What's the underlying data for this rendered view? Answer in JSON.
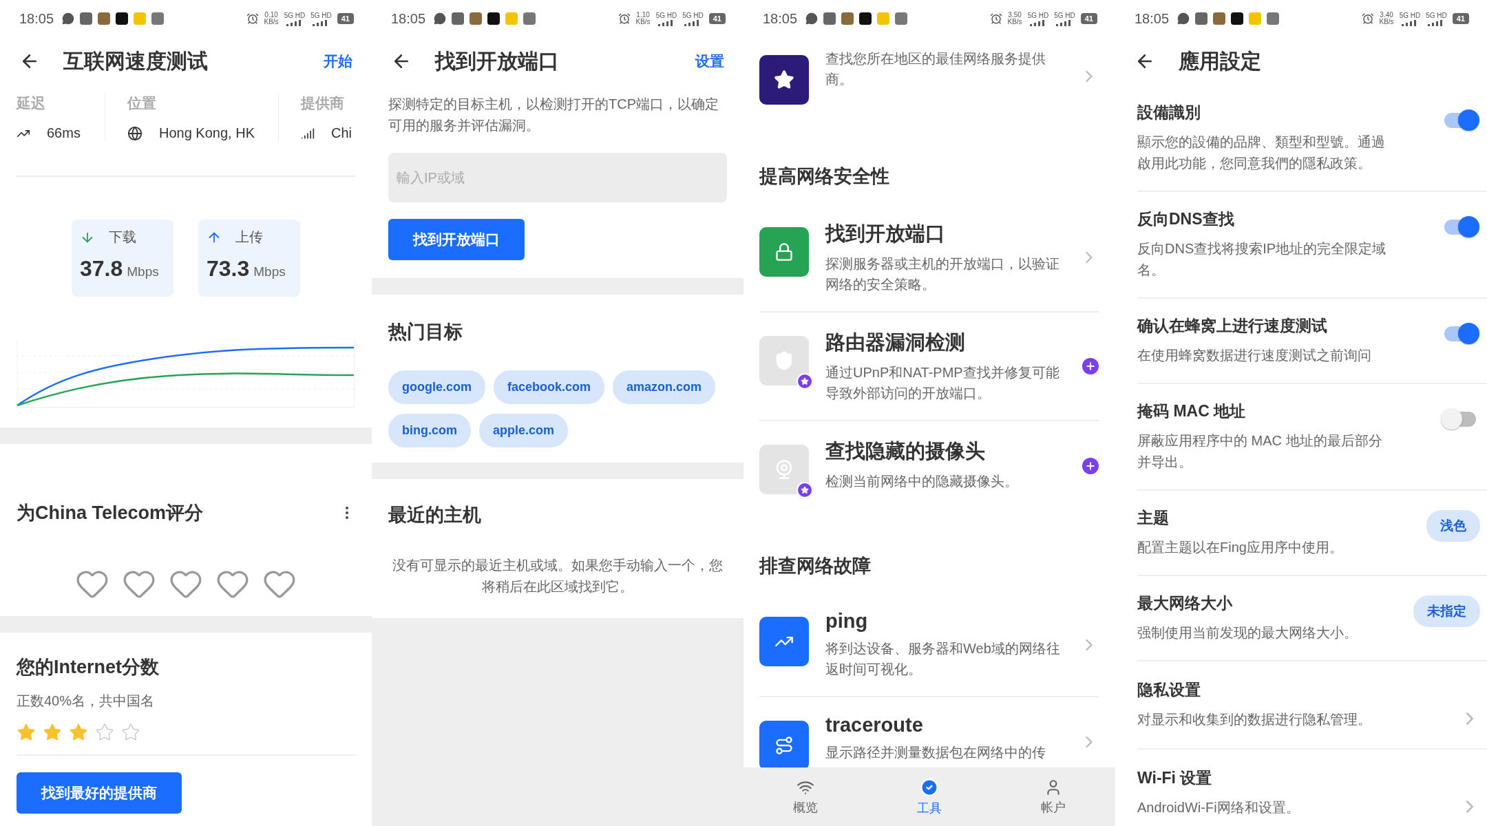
{
  "speed_test": {
    "status_bar": {
      "time": "18:05",
      "speed": "0.10",
      "speed_unit": "KB/s",
      "networks": [
        "5G HD",
        "5G HD"
      ],
      "battery": "41"
    },
    "title": "互联网速度测试",
    "action": "开始",
    "stats": [
      {
        "kind": "latency",
        "label": "延迟",
        "value": "66ms"
      },
      {
        "kind": "location",
        "label": "位置",
        "value": "Hong Kong, HK"
      },
      {
        "kind": "provider",
        "label": "提供商",
        "value": "Chi"
      }
    ],
    "speeds": [
      {
        "kind": "download",
        "label": "下载",
        "value": "37.8",
        "unit": "Mbps"
      },
      {
        "kind": "upload",
        "label": "上传",
        "value": "73.3",
        "unit": "Mbps"
      }
    ],
    "rating": {
      "title": "为China Telecom评分",
      "stars": 0
    },
    "score": {
      "title": "您的Internet分数",
      "subtitle": "正数40%名，共中国名",
      "stars": 3
    },
    "button": "找到最好的提供商"
  },
  "open_ports": {
    "status_bar": {
      "time": "18:05",
      "speed": "1.10",
      "speed_unit": "KB/s",
      "networks": [
        "5G HD",
        "5G HD"
      ],
      "battery": "41"
    },
    "title": "找到开放端口",
    "action": "设置",
    "description": "探测特定的目标主机，以检测打开的TCP端口，以确定可用的服务并评估漏洞。",
    "input": {
      "placeholder": "輸入IP或域"
    },
    "button": "找到开放端口",
    "popular": {
      "title": "热门目标",
      "targets": [
        "google.com",
        "facebook.com",
        "amazon.com",
        "bing.com",
        "apple.com"
      ]
    },
    "recent": {
      "title": "最近的主机",
      "empty_text": "没有可显示的最近主机或域。如果您手动输入一个，您将稍后在此区域找到它。"
    }
  },
  "tools": {
    "status_bar": {
      "time": "18:05",
      "speed": "3.50",
      "speed_unit": "KB/s",
      "networks": [
        "5G HD",
        "5G HD"
      ],
      "battery": "41"
    },
    "sections": [
      {
        "items": [
          {
            "kind": "compare",
            "description": "查找您所在地区的最佳网络服务提供商。",
            "premium": false
          }
        ]
      },
      {
        "title": "提高网络安全性",
        "items": [
          {
            "kind": "lock",
            "title": "找到开放端口",
            "description": "探测服务器或主机的开放端口，以验证网络的安全策略。",
            "premium": false
          },
          {
            "kind": "shield",
            "title": "路由器漏洞检测",
            "description": "通过UPnP和NAT-PMP查找并修复可能导致外部访问的开放端口。",
            "premium": true
          },
          {
            "kind": "camera",
            "title": "查找隐藏的摄像头",
            "description": "检测当前网络中的隐藏摄像头。",
            "premium": true
          }
        ]
      },
      {
        "title": "排查网络故障",
        "items": [
          {
            "kind": "ping",
            "title": "ping",
            "description": "将到达设备、服务器和Web域的网络往返时间可视化。",
            "premium": false
          },
          {
            "kind": "route",
            "title": "traceroute",
            "description": "显示路径并测量数据包在网络中的传",
            "premium": false
          }
        ]
      }
    ],
    "nav": [
      {
        "kind": "overview",
        "label": "概览",
        "selected": false
      },
      {
        "kind": "tools",
        "label": "工具",
        "selected": true
      },
      {
        "kind": "account",
        "label": "帐户",
        "selected": false
      }
    ]
  },
  "settings": {
    "status_bar": {
      "time": "18:05",
      "speed": "3.40",
      "speed_unit": "KB/s",
      "networks": [
        "5G HD",
        "5G HD"
      ],
      "battery": "41"
    },
    "title": "應用設定",
    "rows": [
      {
        "kind": "toggle",
        "title": "設備識別",
        "description": "顯示您的設備的品牌、類型和型號。通過啟用此功能，您同意我們的隱私政策。",
        "on": true
      },
      {
        "kind": "toggle",
        "title": "反向DNS查找",
        "description": "反向DNS查找将搜索IP地址的完全限定域名。",
        "on": true
      },
      {
        "kind": "toggle",
        "title": "确认在蜂窝上进行速度测试",
        "description": "在使用蜂窝数据进行速度测试之前询问",
        "on": true
      },
      {
        "kind": "toggle",
        "title": "掩码 MAC 地址",
        "description": "屏蔽应用程序中的 MAC 地址的最后部分并导出。",
        "on": false
      },
      {
        "kind": "chip",
        "title": "主题",
        "description": "配置主题以在Fing应用序中使用。",
        "value": "浅色"
      },
      {
        "kind": "chip",
        "title": "最大网络大小",
        "description": "强制使用当前发现的最大网络大小。",
        "value": "未指定"
      },
      {
        "kind": "link",
        "title": "隐私设置",
        "description": "对显示和收集到的数据进行隐私管理。"
      },
      {
        "kind": "link",
        "title": "Wi-Fi 设置",
        "description": "AndroidWi-Fi网络和设置。"
      }
    ]
  }
}
